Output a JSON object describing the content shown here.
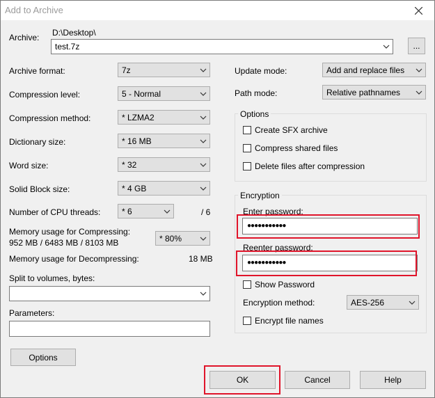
{
  "window": {
    "title": "Add to Archive"
  },
  "archive": {
    "label": "Archive:",
    "path": "D:\\Desktop\\",
    "filename": "test.7z",
    "browse_label": "..."
  },
  "left": {
    "format": {
      "label": "Archive format:",
      "value": "7z"
    },
    "level": {
      "label": "Compression level:",
      "value": "5 - Normal"
    },
    "method": {
      "label": "Compression method:",
      "value": "* LZMA2"
    },
    "dictionary": {
      "label": "Dictionary size:",
      "value": "* 16 MB"
    },
    "word": {
      "label": "Word size:",
      "value": "* 32"
    },
    "solid": {
      "label": "Solid Block size:",
      "value": "* 4 GB"
    },
    "threads": {
      "label": "Number of CPU threads:",
      "value": "* 6",
      "max": "/ 6"
    },
    "mem_compress": {
      "label_line1": "Memory usage for Compressing:",
      "label_line2": "952 MB / 6483 MB / 8103 MB",
      "value": "* 80%"
    },
    "mem_decompress": {
      "label": "Memory usage for Decompressing:",
      "value": "18 MB"
    },
    "split": {
      "label": "Split to volumes, bytes:",
      "value": ""
    },
    "parameters": {
      "label": "Parameters:",
      "value": ""
    },
    "options_button": "Options"
  },
  "right": {
    "update_mode": {
      "label": "Update mode:",
      "value": "Add and replace files"
    },
    "path_mode": {
      "label": "Path mode:",
      "value": "Relative pathnames"
    },
    "options_group": {
      "title": "Options",
      "sfx": "Create SFX archive",
      "shared": "Compress shared files",
      "delete": "Delete files after compression"
    },
    "encryption": {
      "title": "Encryption",
      "enter_label": "Enter password:",
      "enter_value": "●●●●●●●●●●●",
      "reenter_label": "Reenter password:",
      "reenter_value": "●●●●●●●●●●●",
      "show_password": "Show Password",
      "method_label": "Encryption method:",
      "method_value": "AES-256",
      "encrypt_names": "Encrypt file names"
    }
  },
  "buttons": {
    "ok": "OK",
    "cancel": "Cancel",
    "help": "Help"
  },
  "colors": {
    "highlight": "#e0142a"
  }
}
